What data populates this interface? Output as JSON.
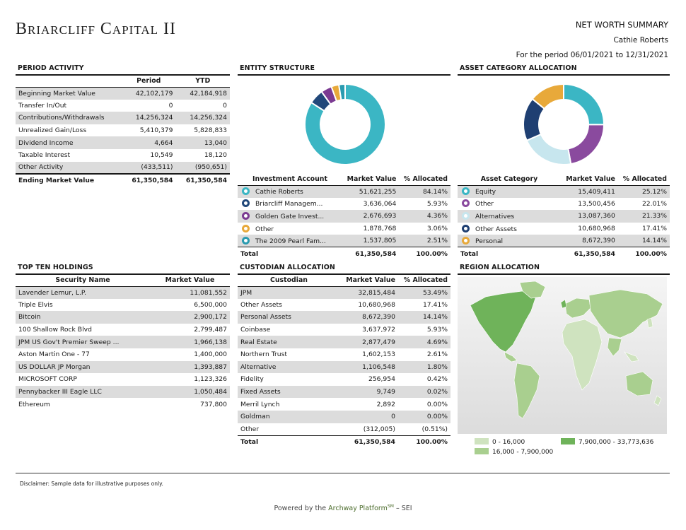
{
  "header": {
    "logo": "Briarcliff Capital II",
    "title": "NET WORTH SUMMARY",
    "client": "Cathie Roberts",
    "period": "For the period 06/01/2021 to 12/31/2021"
  },
  "period_activity": {
    "title": "PERIOD ACTIVITY",
    "col_period": "Period",
    "col_ytd": "YTD",
    "rows": [
      {
        "label": "Beginning Market Value",
        "period": "42,102,179",
        "ytd": "42,184,918"
      },
      {
        "label": "Transfer In/Out",
        "period": "0",
        "ytd": "0"
      },
      {
        "label": "Contributions/Withdrawals",
        "period": "14,256,324",
        "ytd": "14,256,324"
      },
      {
        "label": "Unrealized Gain/Loss",
        "period": "5,410,379",
        "ytd": "5,828,833"
      },
      {
        "label": "Dividend Income",
        "period": "4,664",
        "ytd": "13,040"
      },
      {
        "label": "Taxable Interest",
        "period": "10,549",
        "ytd": "18,120"
      },
      {
        "label": "Other Activity",
        "period": "(433,511)",
        "ytd": "(950,651)"
      }
    ],
    "ending": {
      "label": "Ending Market Value",
      "period": "61,350,584",
      "ytd": "61,350,584"
    }
  },
  "entity_structure": {
    "title": "ENTITY STRUCTURE",
    "col_account": "Investment Account",
    "col_mv": "Market Value",
    "col_pct": "% Allocated",
    "rows": [
      {
        "name": "Cathie Roberts",
        "mv": "51,621,255",
        "pct": "84.14%",
        "color": "#3bb6c4"
      },
      {
        "name": "Briarcliff Managem...",
        "mv": "3,636,064",
        "pct": "5.93%",
        "color": "#21487a"
      },
      {
        "name": "Golden Gate Invest...",
        "mv": "2,676,693",
        "pct": "4.36%",
        "color": "#7b3a92"
      },
      {
        "name": "Other",
        "mv": "1,878,768",
        "pct": "3.06%",
        "color": "#e8a93a"
      },
      {
        "name": "The 2009 Pearl Fam...",
        "mv": "1,537,805",
        "pct": "2.51%",
        "color": "#2a9bb0"
      }
    ],
    "total": {
      "label": "Total",
      "mv": "61,350,584",
      "pct": "100.00%"
    }
  },
  "asset_allocation": {
    "title": "ASSET CATEGORY ALLOCATION",
    "col_cat": "Asset Category",
    "col_mv": "Market Value",
    "col_pct": "% Allocated",
    "rows": [
      {
        "name": "Equity",
        "mv": "15,409,411",
        "pct": "25.12%",
        "color": "#3bb6c4"
      },
      {
        "name": "Other",
        "mv": "13,500,456",
        "pct": "22.01%",
        "color": "#8a4a9e"
      },
      {
        "name": "Alternatives",
        "mv": "13,087,360",
        "pct": "21.33%",
        "color": "#c7e6ee"
      },
      {
        "name": "Other Assets",
        "mv": "10,680,968",
        "pct": "17.41%",
        "color": "#1f3f72"
      },
      {
        "name": "Personal",
        "mv": "8,672,390",
        "pct": "14.14%",
        "color": "#e8a93a"
      }
    ],
    "total": {
      "label": "Total",
      "mv": "61,350,584",
      "pct": "100.00%"
    }
  },
  "top_holdings": {
    "title": "TOP TEN HOLDINGS",
    "col_name": "Security Name",
    "col_mv": "Market Value",
    "rows": [
      {
        "name": "Lavender Lemur, L.P.",
        "mv": "11,081,552"
      },
      {
        "name": "Triple Elvis",
        "mv": "6,500,000"
      },
      {
        "name": "Bitcoin",
        "mv": "2,900,172"
      },
      {
        "name": "100 Shallow Rock Blvd",
        "mv": "2,799,487"
      },
      {
        "name": "JPM US Gov't Premier Sweep ...",
        "mv": "1,966,138"
      },
      {
        "name": "Aston Martin One - 77",
        "mv": "1,400,000"
      },
      {
        "name": "US DOLLAR JP Morgan",
        "mv": "1,393,887"
      },
      {
        "name": "MICROSOFT CORP",
        "mv": "1,123,326"
      },
      {
        "name": "Pennybacker III Eagle LLC",
        "mv": "1,050,484"
      },
      {
        "name": "Ethereum",
        "mv": "737,800"
      }
    ]
  },
  "custodian": {
    "title": "CUSTODIAN ALLOCATION",
    "col_name": "Custodian",
    "col_mv": "Market Value",
    "col_pct": "% Allocated",
    "rows": [
      {
        "name": "JPM",
        "mv": "32,815,484",
        "pct": "53.49%"
      },
      {
        "name": "Other Assets",
        "mv": "10,680,968",
        "pct": "17.41%"
      },
      {
        "name": "Personal Assets",
        "mv": "8,672,390",
        "pct": "14.14%"
      },
      {
        "name": "Coinbase",
        "mv": "3,637,972",
        "pct": "5.93%"
      },
      {
        "name": "Real Estate",
        "mv": "2,877,479",
        "pct": "4.69%"
      },
      {
        "name": "Northern Trust",
        "mv": "1,602,153",
        "pct": "2.61%"
      },
      {
        "name": "Alternative",
        "mv": "1,106,548",
        "pct": "1.80%"
      },
      {
        "name": "Fidelity",
        "mv": "256,954",
        "pct": "0.42%"
      },
      {
        "name": "Fixed Assets",
        "mv": "9,749",
        "pct": "0.02%"
      },
      {
        "name": "Merril Lynch",
        "mv": "2,892",
        "pct": "0.00%"
      },
      {
        "name": "Goldman",
        "mv": "0",
        "pct": "0.00%"
      },
      {
        "name": "Other",
        "mv": "(312,005)",
        "pct": "(0.51%)"
      }
    ],
    "total": {
      "label": "Total",
      "mv": "61,350,584",
      "pct": "100.00%"
    }
  },
  "region": {
    "title": "REGION ALLOCATION",
    "legend": [
      {
        "label": "0 - 16,000",
        "color": "#cfe3bf"
      },
      {
        "label": "16,000 - 7,900,000",
        "color": "#a9cf8f"
      },
      {
        "label": "7,900,000 - 33,773,636",
        "color": "#6fb35a"
      }
    ]
  },
  "disclaimer": "Disclaimer: Sample data for illustrative purposes only.",
  "footer": {
    "prefix": "Powered by the",
    "brand": "Archway Platform",
    "sup": "SM",
    "suffix": "– SEI"
  },
  "chart_data": [
    {
      "type": "pie",
      "title": "ENTITY STRUCTURE",
      "categories": [
        "Cathie Roberts",
        "Briarcliff Managem...",
        "Golden Gate Invest...",
        "Other",
        "The 2009 Pearl Fam..."
      ],
      "values": [
        84.14,
        5.93,
        4.36,
        3.06,
        2.51
      ],
      "colors": [
        "#3bb6c4",
        "#21487a",
        "#7b3a92",
        "#e8a93a",
        "#2a9bb0"
      ]
    },
    {
      "type": "pie",
      "title": "ASSET CATEGORY ALLOCATION",
      "categories": [
        "Equity",
        "Other",
        "Alternatives",
        "Other Assets",
        "Personal"
      ],
      "values": [
        25.12,
        22.01,
        21.33,
        17.41,
        14.14
      ],
      "colors": [
        "#3bb6c4",
        "#8a4a9e",
        "#c7e6ee",
        "#1f3f72",
        "#e8a93a"
      ]
    }
  ]
}
